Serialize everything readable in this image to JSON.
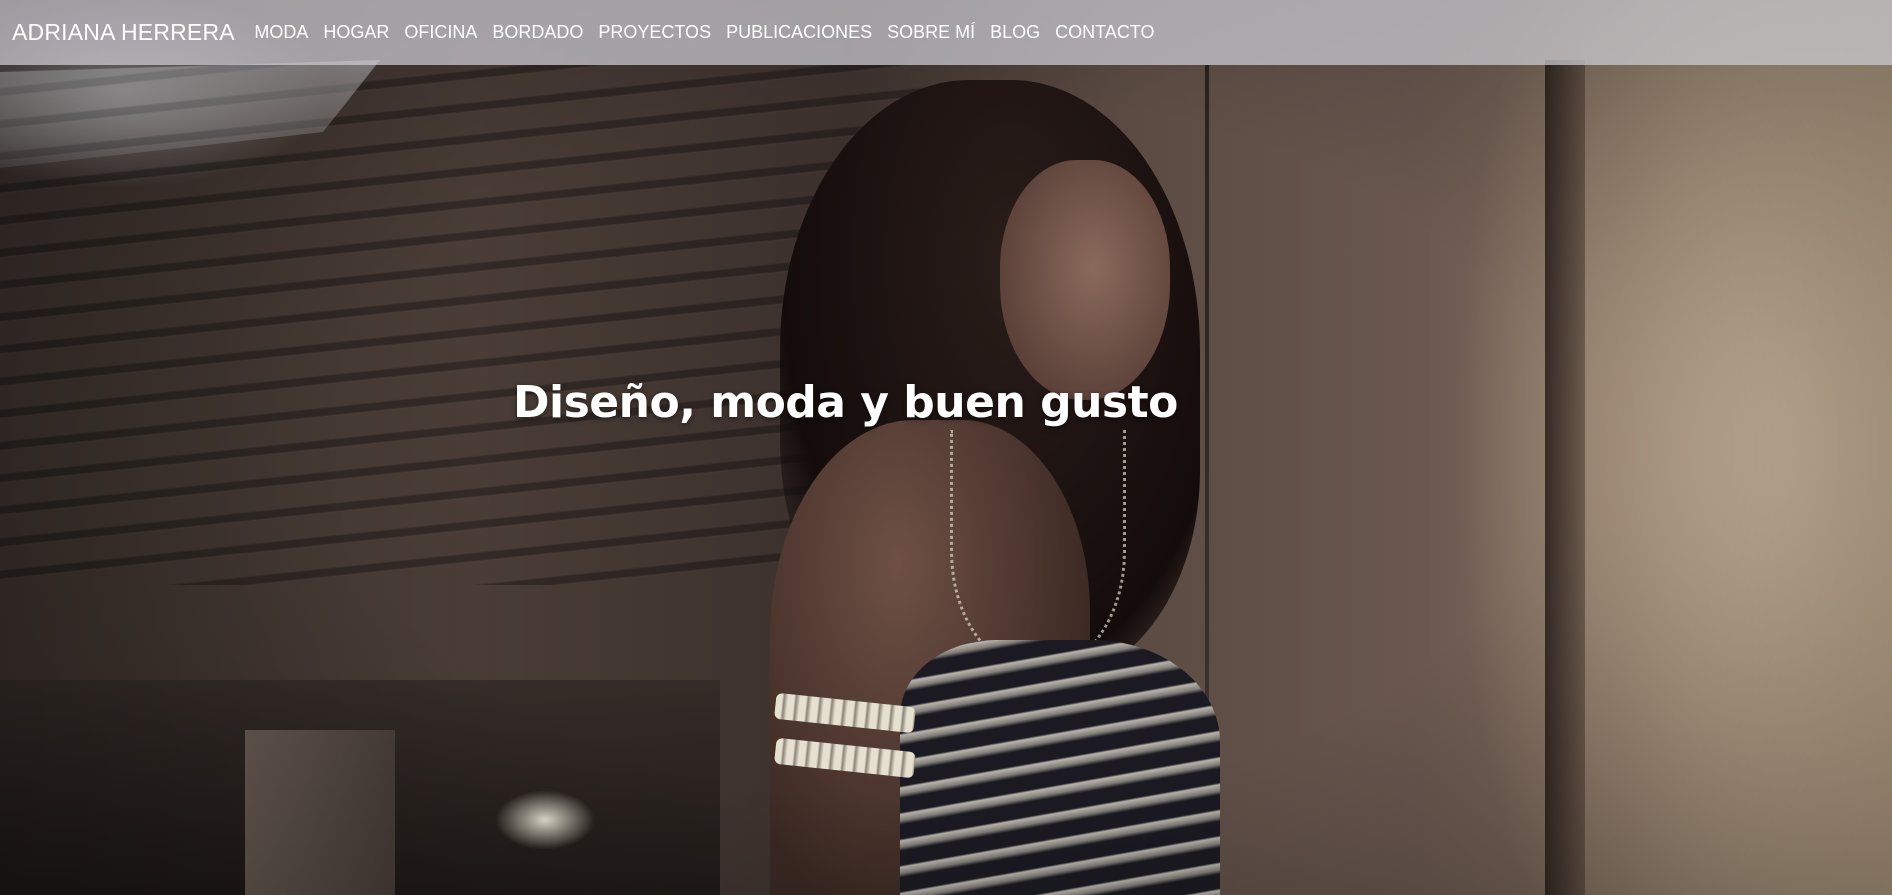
{
  "header": {
    "brand": "ADRIANA HERRERA",
    "nav": [
      {
        "label": "MODA"
      },
      {
        "label": "HOGAR"
      },
      {
        "label": "OFICINA"
      },
      {
        "label": "BORDADO"
      },
      {
        "label": "PROYECTOS"
      },
      {
        "label": "PUBLICACIONES"
      },
      {
        "label": "SOBRE MÍ"
      },
      {
        "label": "BLOG"
      },
      {
        "label": "CONTACTO"
      }
    ]
  },
  "hero": {
    "title": "Diseño, moda y buen gusto",
    "image": "fashion-model-photo"
  },
  "colors": {
    "navbar_bg": "#cdcdd4",
    "text": "#ffffff"
  }
}
